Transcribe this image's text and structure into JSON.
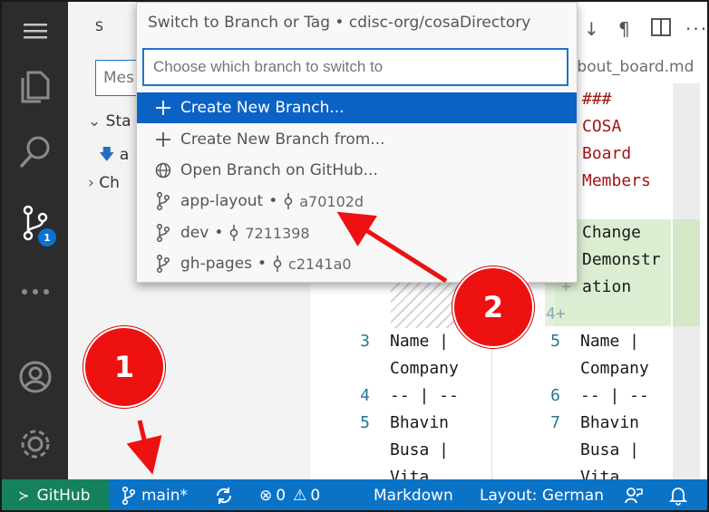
{
  "quick_pick": {
    "title": "Switch to Branch or Tag • cdisc-org/cosaDirectory",
    "placeholder": "Choose which branch to switch to",
    "items": [
      {
        "label": "Create New Branch...",
        "icon": "plus-icon"
      },
      {
        "label": "Create New Branch from...",
        "icon": "plus-icon"
      },
      {
        "label": "Open Branch on GitHub...",
        "icon": "globe-icon"
      },
      {
        "label": "app-layout",
        "commit": "a70102d",
        "icon": "git-branch-icon"
      },
      {
        "label": "dev",
        "commit": "7211398",
        "icon": "git-branch-icon"
      },
      {
        "label": "gh-pages",
        "commit": "c2141a0",
        "icon": "git-branch-icon"
      }
    ],
    "separator": "•"
  },
  "sidebar": {
    "header_char": "S",
    "message_placeholder": "Mes",
    "staged_label": "Sta",
    "file_label": "a",
    "changes_label": "Ch"
  },
  "activity_bar": {
    "source_control_badge": "1",
    "icons": [
      "menu-icon",
      "explorer-icon",
      "search-icon",
      "source-control-icon",
      "more-icon",
      "account-icon",
      "settings-gear-icon"
    ]
  },
  "editor": {
    "tab_label": "about_board.md",
    "left_lines": [
      {
        "num": "3",
        "text": "Name |"
      },
      {
        "num": "",
        "text": "Company"
      },
      {
        "num": "4",
        "text": "-- | --"
      },
      {
        "num": "5",
        "text": "Bhavin"
      },
      {
        "num": "",
        "text": "Busa |"
      },
      {
        "num": "",
        "text": "Vita"
      }
    ],
    "right_header": [
      "###",
      "COSA",
      "Board",
      "Members"
    ],
    "right_added": [
      "Change",
      "Demonstr",
      "ation"
    ],
    "right_added_line": "4+",
    "right_plus": "+",
    "right_lines": [
      {
        "num": "5",
        "text": "Name |"
      },
      {
        "num": "",
        "text": "Company"
      },
      {
        "num": "6",
        "text": "-- | --"
      },
      {
        "num": "7",
        "text": "Bhavin"
      },
      {
        "num": "",
        "text": "Busa |"
      },
      {
        "num": "",
        "text": "Vita"
      }
    ]
  },
  "status_bar": {
    "remote": "GitHub",
    "branch": "main*",
    "errors": "0",
    "warnings": "0",
    "language": "Markdown",
    "layout": "Layout: German"
  },
  "callouts": {
    "first": "1",
    "second": "2"
  },
  "colors": {
    "accent": "#0a63c4",
    "statusbar": "#0b73c6",
    "remote": "#16825d",
    "callout": "#ee1111",
    "heading_text": "#a31515"
  }
}
